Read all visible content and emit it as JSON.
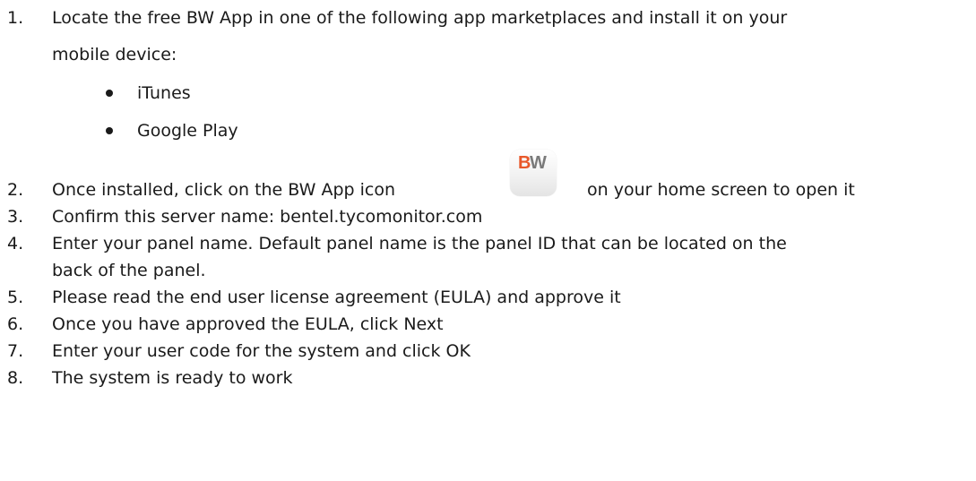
{
  "steps": [
    {
      "number": "1.",
      "line1": "Locate the free BW App in one of the following app marketplaces and install it on your",
      "line2": "mobile device:",
      "bullets": [
        "iTunes",
        "Google Play"
      ]
    },
    {
      "number": "2.",
      "before_icon": "Once installed, click on the BW App icon",
      "after_icon": "on your home screen to open it",
      "icon": {
        "name": "bw-app-icon",
        "letter1": "B",
        "letter2": "W",
        "accent": "#e8582a",
        "secondary": "#7a7a7a"
      }
    },
    {
      "number": "3.",
      "line1": "Confirm this server name: bentel.tycomonitor.com"
    },
    {
      "number": "4.",
      "line1": "Enter your panel name. Default panel name is the panel ID that can be located on the",
      "line2": "back of the panel."
    },
    {
      "number": "5.",
      "line1": "Please read the end user license agreement (EULA) and approve it"
    },
    {
      "number": "6.",
      "line1": "Once you have approved the EULA, click Next"
    },
    {
      "number": "7.",
      "line1": "Enter your user code for the system and click OK"
    },
    {
      "number": "8.",
      "line1": "The system is ready to work"
    }
  ]
}
